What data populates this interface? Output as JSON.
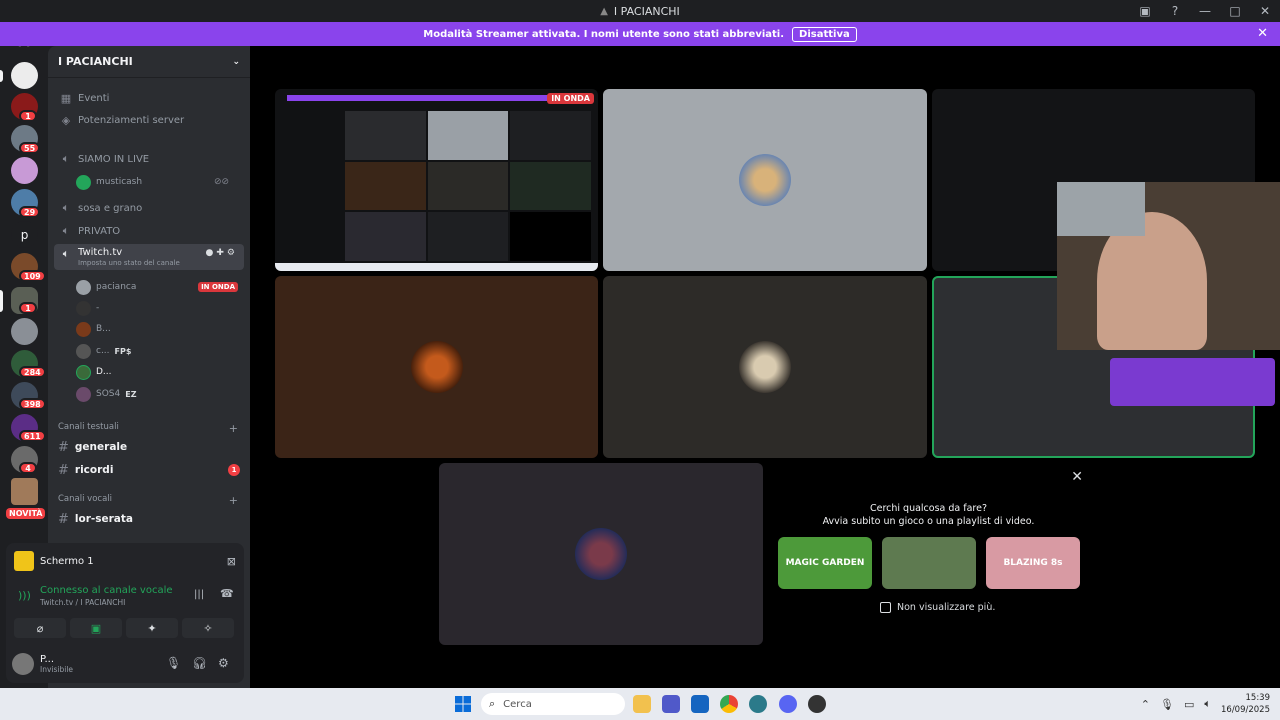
{
  "window": {
    "title": "I PACIANCHI"
  },
  "banner": {
    "text": "Modalità Streamer attivata. I nomi utente sono stati abbreviati.",
    "button": "Disattiva"
  },
  "rail": {
    "badges": [
      "1",
      "55",
      "29",
      "109",
      "1",
      "284",
      "398",
      "611",
      "4"
    ],
    "server_letter": "p",
    "novita": "NOVITÀ"
  },
  "sidebar": {
    "server_name": "I PACIANCHI",
    "events": "Eventi",
    "boosts": "Potenziamenti server",
    "voice_channels": [
      {
        "name": "SIAMO IN LIVE"
      },
      {
        "name": "sosa e grano"
      },
      {
        "name": "PRIVATO"
      },
      {
        "name": "Twitch.tv",
        "status": "Imposta uno stato del canale"
      }
    ],
    "live_member": "musticash",
    "members": [
      {
        "name": "pacianca",
        "tag": "IN ONDA"
      },
      {
        "name": "-"
      },
      {
        "name": "B..."
      },
      {
        "name": "c...",
        "extra": "FP$"
      },
      {
        "name": "D..."
      },
      {
        "name": "SOS4",
        "extra": "EZ"
      }
    ],
    "text_category": "Canali testuali",
    "text_channels": [
      {
        "name": "generale"
      },
      {
        "name": "ricordi",
        "mentions": "1"
      }
    ],
    "voice_category": "Canali vocali",
    "voice_text_channel": "lor-serata"
  },
  "screen_panel": {
    "title": "Schermo 1",
    "connection": "Connesso al canale vocale",
    "connection_sub": "Twitch.tv / I PACIANCHI"
  },
  "user": {
    "name": "P...",
    "status": "Invisibile"
  },
  "stage": {
    "live_badge": "IN ONDA"
  },
  "activity": {
    "question": "Cerchi qualcosa da fare?",
    "subtitle": "Avvia subito un gioco o una playlist di video.",
    "games": [
      "MAGIC GARDEN",
      "",
      "BLAZING 8s"
    ],
    "dont_show": "Non visualizzare più."
  },
  "taskbar": {
    "search_placeholder": "Cerca",
    "time": "15:39",
    "date": "16/09/2025"
  }
}
